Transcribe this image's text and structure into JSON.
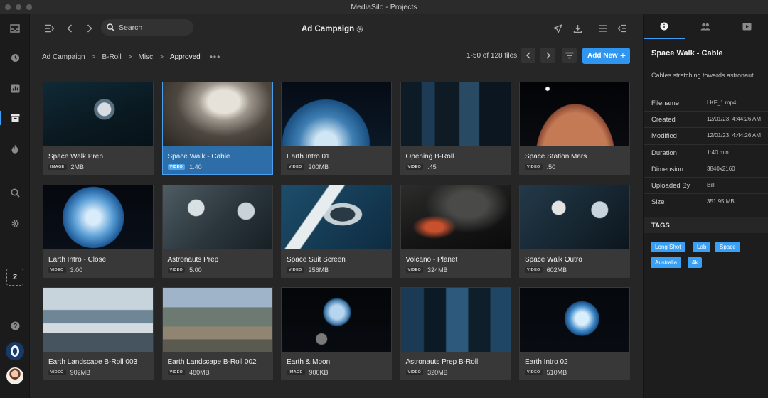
{
  "window": {
    "title": "MediaSilo",
    "subtitle": "Projects",
    "title_full": "MediaSilo  -  Projects"
  },
  "rail": {
    "icons": [
      "inbox-icon",
      "clock-icon",
      "chart-icon",
      "archive-icon",
      "flame-icon",
      "search-icon",
      "gear-icon",
      "help-icon"
    ],
    "active": "archive-icon",
    "count_badge": "2"
  },
  "toolbar": {
    "search_placeholder": "Search",
    "project_title": "Ad Campaign"
  },
  "breadcrumb": [
    "Ad Campaign",
    "B-Roll",
    "Misc",
    "Approved"
  ],
  "breadcrumb_more": "•••",
  "pagination": {
    "text": "1-50 of 128 files"
  },
  "add_new_label": "Add New",
  "assets": [
    {
      "title": "Space Walk Prep",
      "type": "IMAGE",
      "meta": "2MB"
    },
    {
      "title": "Space Walk - Cable",
      "type": "VIDEO",
      "meta": "1:40",
      "selected": true
    },
    {
      "title": "Earth Intro 01",
      "type": "VIDEO",
      "meta": "200MB"
    },
    {
      "title": "Opening B-Roll",
      "type": "VIDEO",
      "meta": ":45"
    },
    {
      "title": "Space Station Mars",
      "type": "VIDEO",
      "meta": ":50"
    },
    {
      "title": "Earth Intro - Close",
      "type": "VIDEO",
      "meta": "3:00"
    },
    {
      "title": "Astronauts Prep",
      "type": "VIDEO",
      "meta": "5:00"
    },
    {
      "title": "Space Suit Screen",
      "type": "VIDEO",
      "meta": "256MB"
    },
    {
      "title": "Volcano - Planet",
      "type": "VIDEO",
      "meta": "324MB"
    },
    {
      "title": "Space Walk Outro",
      "type": "VIDEO",
      "meta": "602MB"
    },
    {
      "title": "Earth Landscape B-Roll 003",
      "type": "VIDEO",
      "meta": "902MB"
    },
    {
      "title": "Earth Landscape B-Roll 002",
      "type": "VIDEO",
      "meta": "480MB"
    },
    {
      "title": "Earth & Moon",
      "type": "IMAGE",
      "meta": "900KB"
    },
    {
      "title": "Astronauts Prep B-Roll",
      "type": "VIDEO",
      "meta": "320MB"
    },
    {
      "title": "Earth Intro 02",
      "type": "VIDEO",
      "meta": "510MB"
    }
  ],
  "details": {
    "tabs": [
      "info-icon",
      "people-icon",
      "play-icon"
    ],
    "title": "Space Walk - Cable",
    "description": "Cables  stretching towards astronaut.",
    "rows": [
      {
        "key": "Filename",
        "value": "LKF_1.mp4"
      },
      {
        "key": "Created",
        "value": "12/01/23, 4:44:26 AM"
      },
      {
        "key": "Modified",
        "value": "12/01/23, 4:44:26 AM"
      },
      {
        "key": "Duration",
        "value": "1:40 min"
      },
      {
        "key": "Dimension",
        "value": "3840x2160"
      },
      {
        "key": "Uploaded By",
        "value": "Bill"
      },
      {
        "key": "Size",
        "value": "351.95 MB"
      }
    ],
    "tags_heading": "TAGS",
    "tags": [
      "Long Shot",
      "Lab",
      "Space",
      "Australia",
      "4k"
    ]
  },
  "colors": {
    "accent": "#3aa0f5",
    "selected_card": "#2d6ea8",
    "background": "#262626"
  }
}
